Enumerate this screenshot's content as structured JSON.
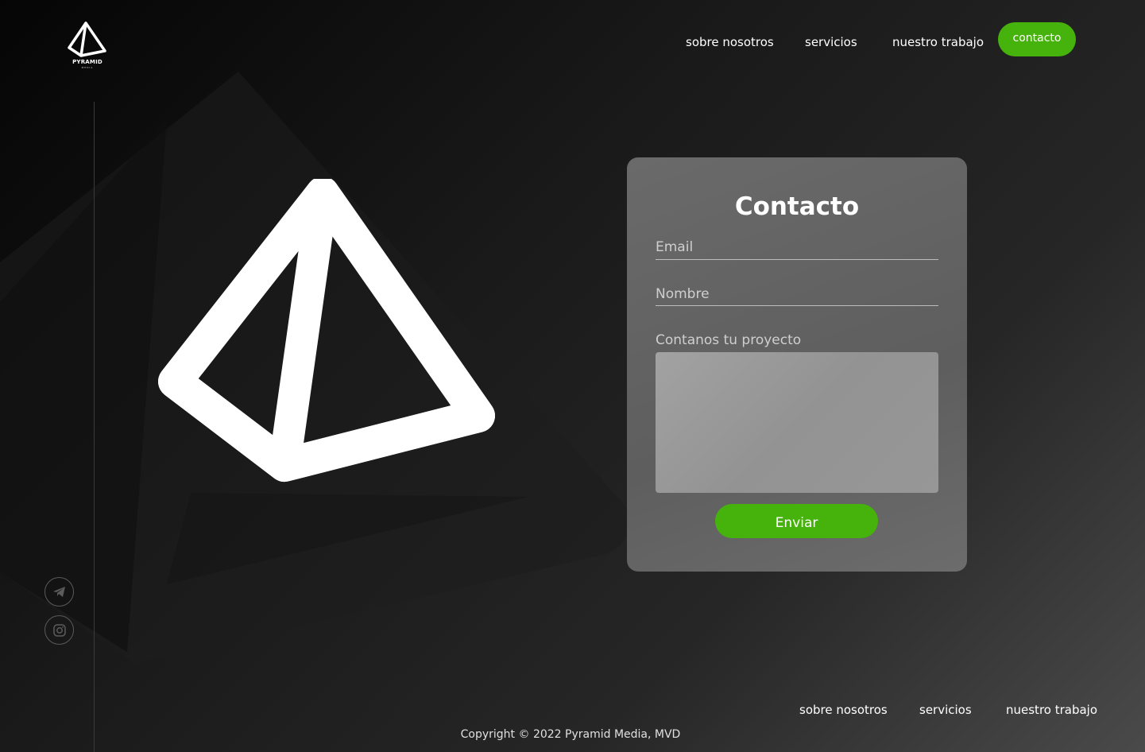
{
  "header": {
    "logo_text": "PYRAMID",
    "logo_subtext": "MEDIA",
    "nav": [
      "sobre nosotros",
      "servicios",
      "nuestro trabajo"
    ],
    "contact_button": "contacto"
  },
  "form": {
    "title": "Contacto",
    "email_label": "Email",
    "name_label": "Nombre",
    "project_label": "Contanos tu proyecto",
    "submit": "Enviar"
  },
  "social": [
    "telegram-icon",
    "instagram-icon"
  ],
  "footer": {
    "nav": [
      "sobre nosotros",
      "servicios",
      "nuestro trabajo"
    ],
    "copyright": "Copyright © 2022 Pyramid Media, MVD"
  },
  "colors": {
    "accent": "#45b30b",
    "card": "#666666"
  }
}
